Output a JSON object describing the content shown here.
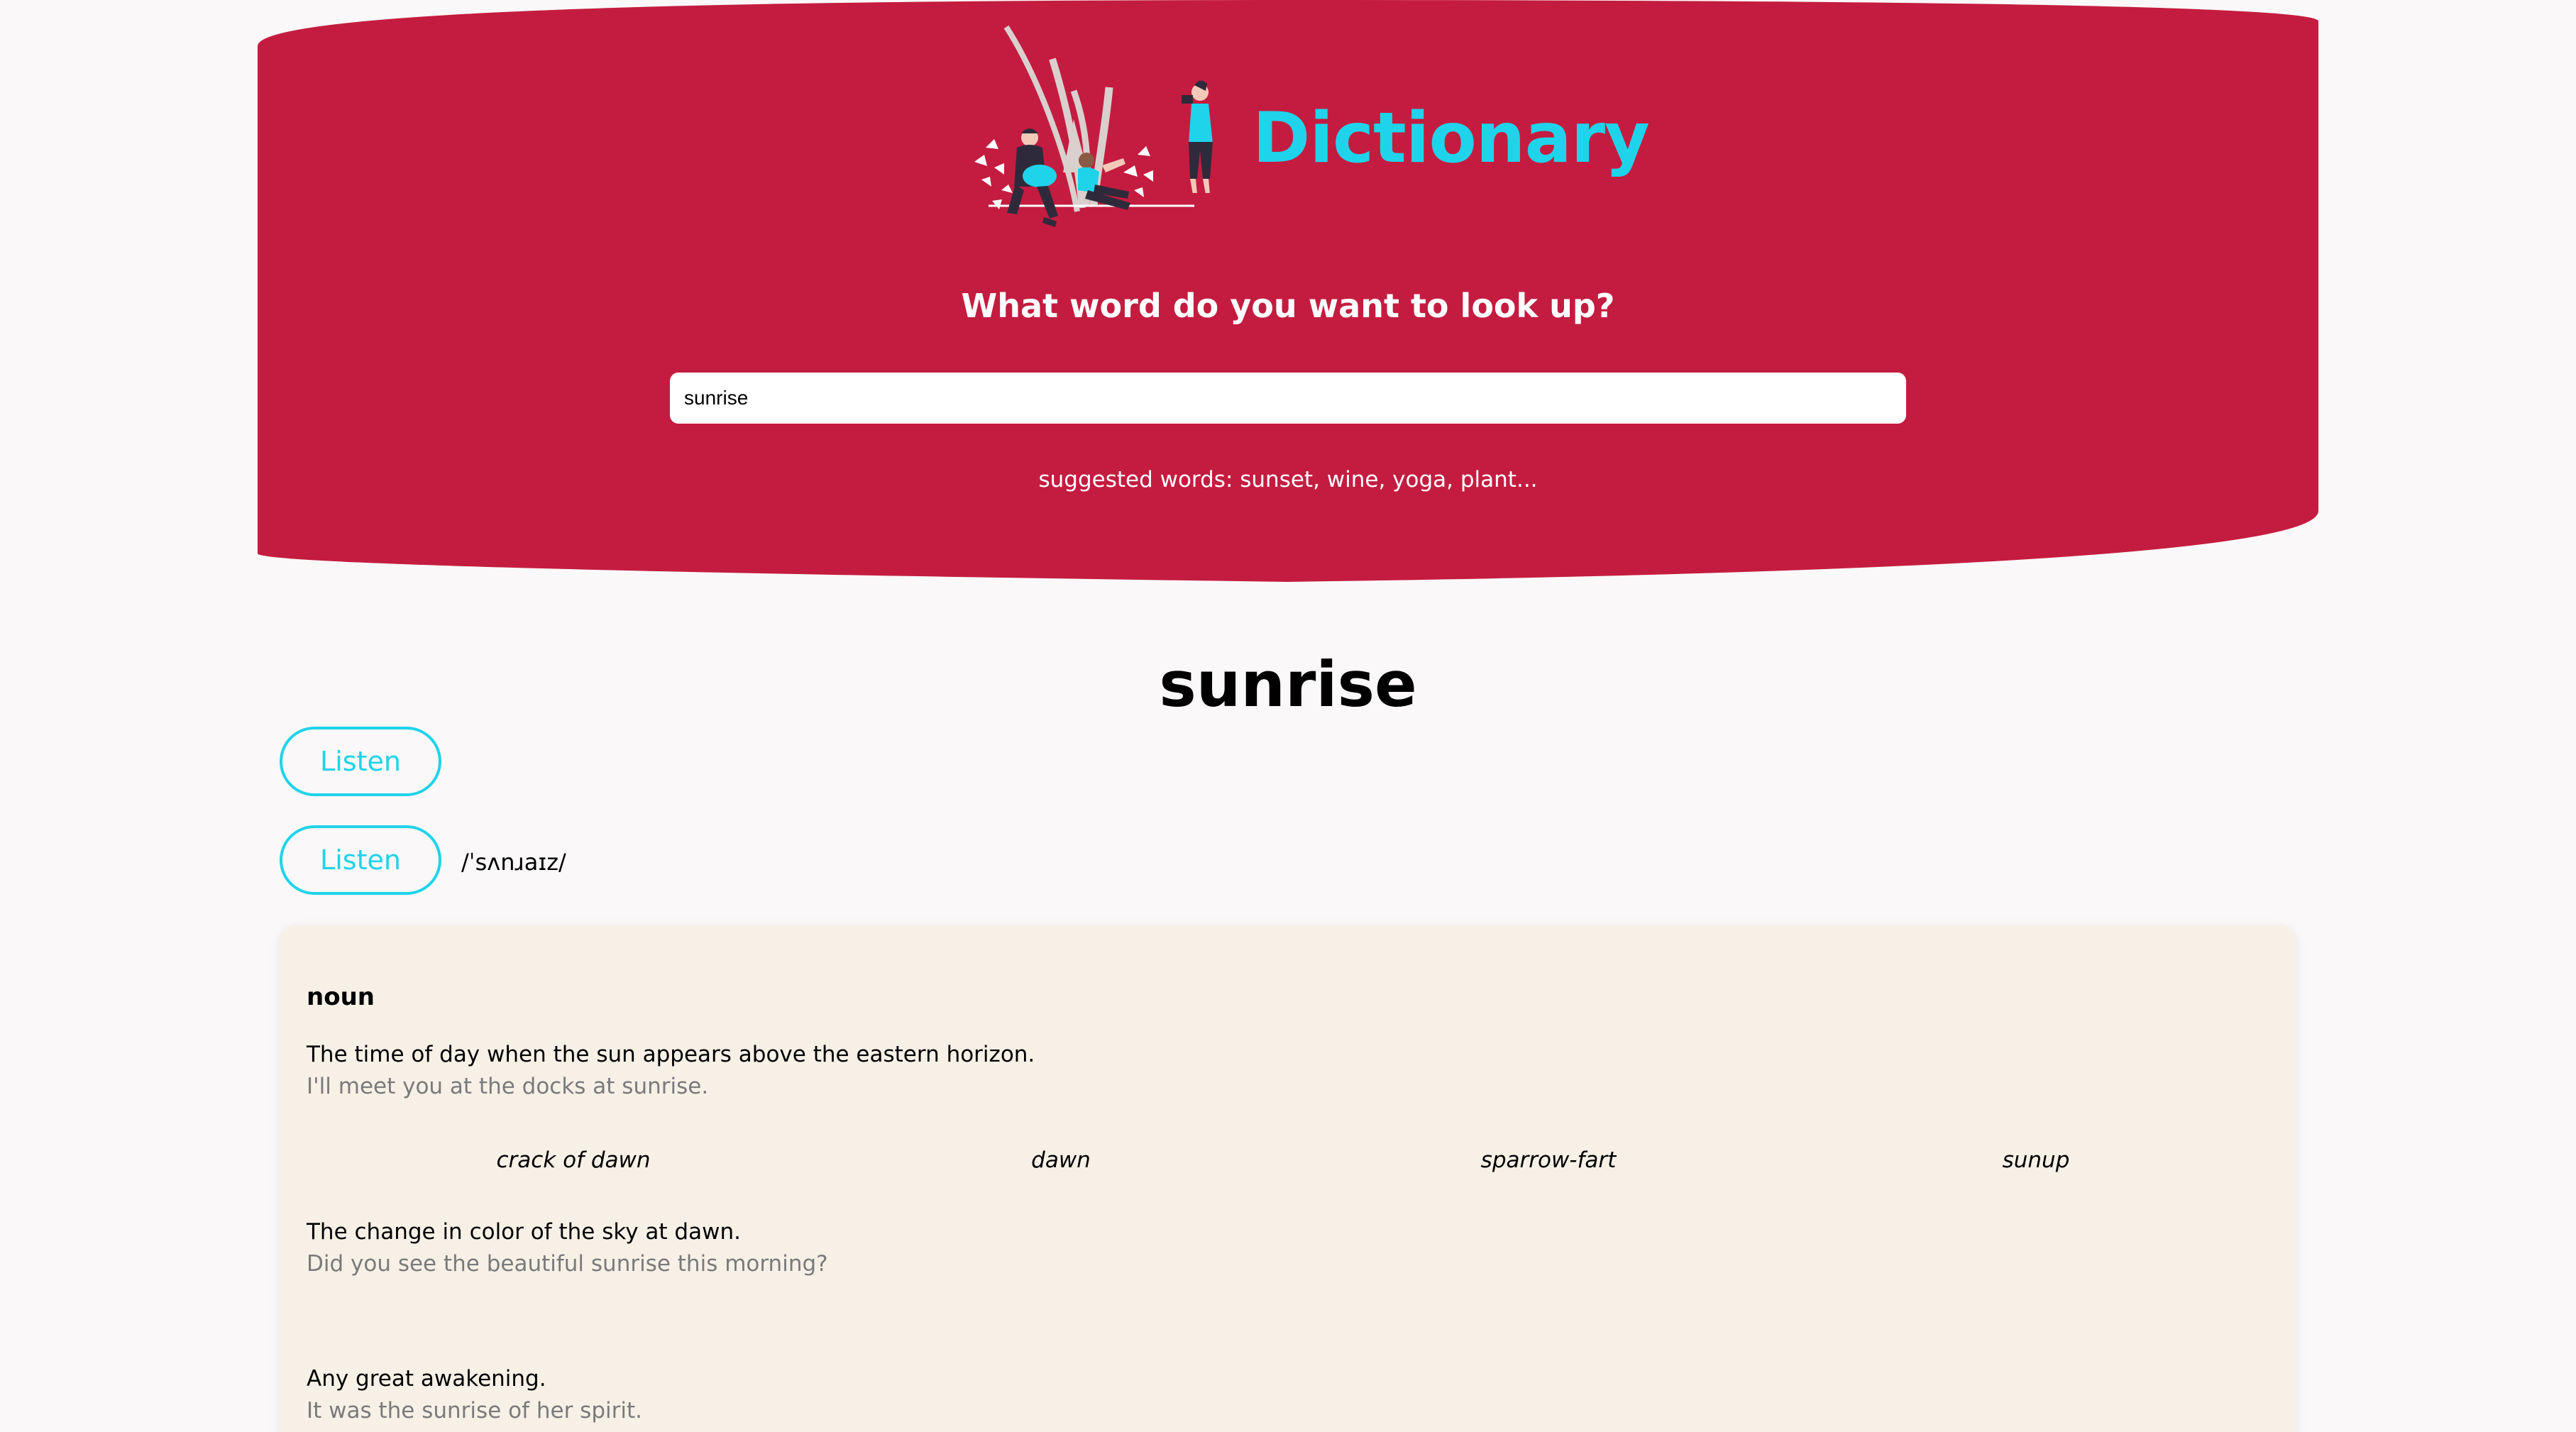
{
  "app": {
    "title": "Dictionary",
    "illustration_icon": "people-outdoors-illustration"
  },
  "colors": {
    "hero_background": "#c41c40",
    "accent": "#1fd3ea",
    "page_background": "#faf8f8",
    "card_background": "#f7f0e7",
    "example_text": "#7a7a7a"
  },
  "search": {
    "question": "What word do you want to look up?",
    "value": "sunrise",
    "suggestions": "suggested words: sunset, wine, yoga, plant..."
  },
  "result": {
    "word": "sunrise",
    "listen_buttons": [
      "Listen",
      "Listen"
    ],
    "phonetic": "/ˈsʌnɹaɪz/",
    "meaning": {
      "part_of_speech": "noun",
      "definitions": [
        {
          "definition": "The time of day when the sun appears above the eastern horizon.",
          "example": "I'll meet you at the docks at sunrise."
        },
        {
          "definition": "The change in color of the sky at dawn.",
          "example": "Did you see the beautiful sunrise this morning?"
        },
        {
          "definition": "Any great awakening.",
          "example": "It was the sunrise of her spirit."
        }
      ],
      "synonyms": [
        "crack of dawn",
        "dawn",
        "sparrow-fart",
        "sunup"
      ]
    }
  }
}
